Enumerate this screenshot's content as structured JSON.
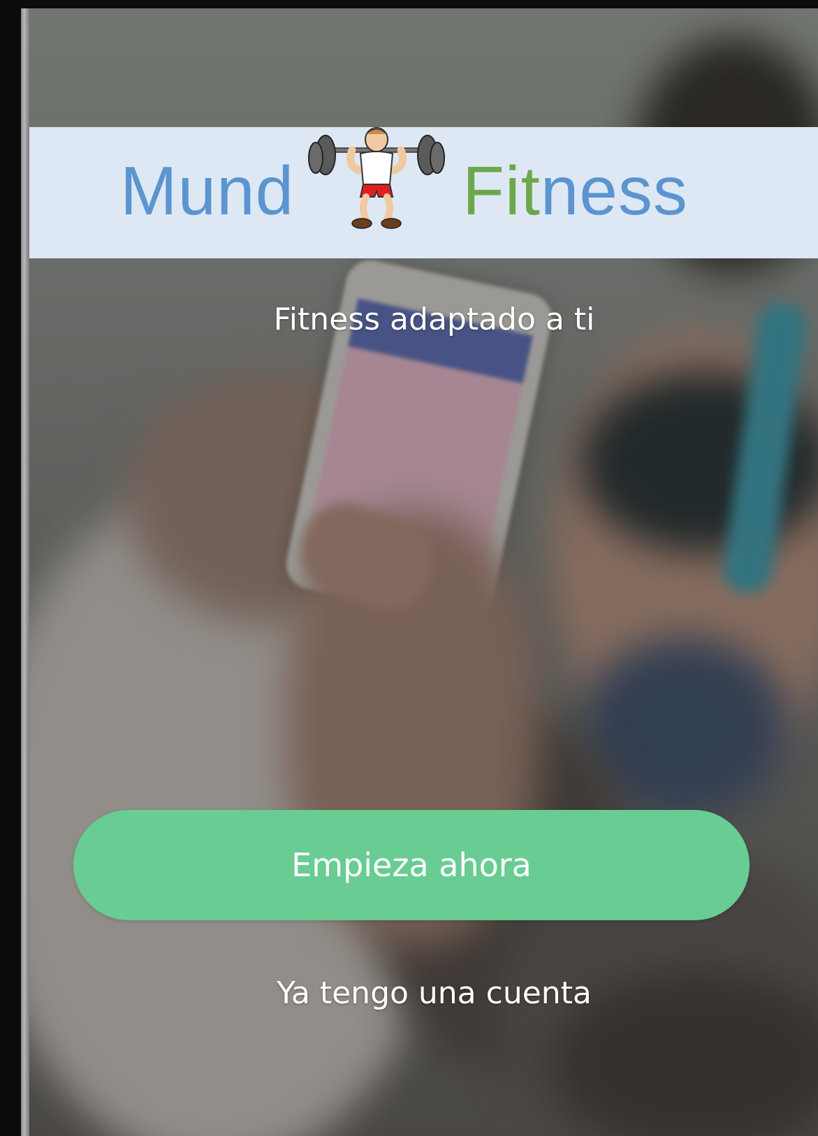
{
  "logo": {
    "word_left": "Mund",
    "word_right_first": "Fit",
    "word_right_rest": "ness",
    "figure_icon": "weightlifter-icon"
  },
  "tagline": "Fitness adaptado a ti",
  "primary_action": {
    "label": "Empieza ahora",
    "color": "#68cc93"
  },
  "secondary_action": {
    "label": "Ya tengo una cuenta"
  },
  "colors": {
    "banner": "#dde8f4",
    "logo_blue": "#5b95cf",
    "logo_green": "#6ca84b",
    "text": "#ffffff"
  }
}
